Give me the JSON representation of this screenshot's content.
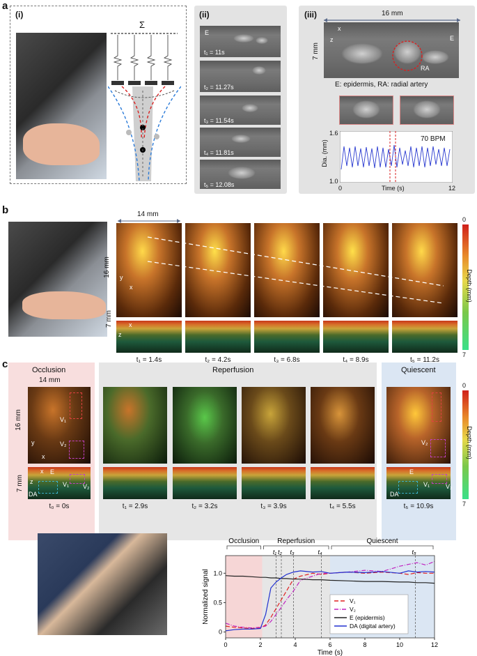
{
  "a": {
    "letter": "a",
    "i": {
      "label": "(i)",
      "sigma": "Σ"
    },
    "ii": {
      "label": "(ii)",
      "e_label": "E",
      "frames": [
        "t₁ = 11s",
        "t₂ = 11.27s",
        "t₃ = 11.54s",
        "t₄ = 11.81s",
        "t₅ = 12.08s"
      ]
    },
    "iii": {
      "label": "(iii)",
      "width": "16 mm",
      "height": "7 mm",
      "e_label": "E",
      "ra_label": "RA",
      "legend": "E: epidermis, RA: radial artery",
      "bpm": "70 BPM",
      "ylabel": "Dia. (mm)",
      "xlabel": "Time (s)",
      "yticks": [
        "1.6",
        "1.0"
      ],
      "xticks": [
        "0",
        "12"
      ],
      "axis_x": "x",
      "axis_z": "z"
    }
  },
  "b": {
    "letter": "b",
    "width": "14 mm",
    "height_top": "16 mm",
    "height_side": "7 mm",
    "depth_label": "Depth (mm)",
    "depth_min": "0",
    "depth_max": "7",
    "frames": [
      "t₁ = 1.4s",
      "t₂ = 4.2s",
      "t₃ = 6.8s",
      "t₄ = 8.9s",
      "t₅ = 11.2s"
    ],
    "axis_x": "x",
    "axis_y": "y",
    "axis_z": "z"
  },
  "c": {
    "letter": "c",
    "occlusion": "Occlusion",
    "reperfusion": "Reperfusion",
    "quiescent": "Quiescent",
    "width": "14 mm",
    "height_top": "16 mm",
    "height_side": "7 mm",
    "depth_label": "Depth (mm)",
    "depth_min": "0",
    "depth_max": "7",
    "v1": "V₁",
    "v2": "V₂",
    "e": "E",
    "da": "DA",
    "axis_x": "x",
    "axis_y": "y",
    "axis_z": "z",
    "frames": [
      "t₀ = 0s",
      "t₁ = 2.9s",
      "t₂ = 3.2s",
      "t₃ = 3.9s",
      "t₄ = 5.5s",
      "t₅ = 10.9s"
    ]
  },
  "chart_data": {
    "type": "line",
    "ylabel": "Normalized signal",
    "xlabel": "Time (s)",
    "xlim": [
      0,
      12
    ],
    "ylim": [
      -0.1,
      1.3
    ],
    "xticks": [
      "0",
      "2",
      "4",
      "6",
      "8",
      "10",
      "12"
    ],
    "yticks": [
      "0",
      "0.5",
      "1.0"
    ],
    "phase_labels": [
      "Occlusion",
      "Reperfusion",
      "Quiescent"
    ],
    "marker_labels": [
      "t₁",
      "t₂",
      "t₃",
      "t₄",
      "t₅"
    ],
    "markers": [
      2.9,
      3.2,
      3.9,
      5.5,
      10.9
    ],
    "shaded": [
      {
        "from": 0,
        "to": 2.1,
        "color": "#f6d6d6"
      },
      {
        "from": 2.1,
        "to": 6.0,
        "color": "#e6e6e6"
      },
      {
        "from": 6.0,
        "to": 12,
        "color": "#dbe6f3"
      }
    ],
    "x": [
      0,
      0.5,
      1,
      1.5,
      2,
      2.3,
      2.6,
      2.9,
      3.2,
      3.5,
      3.9,
      4.3,
      5,
      5.5,
      6,
      7,
      8,
      9,
      10,
      10.5,
      11,
      11.5,
      12
    ],
    "series": [
      {
        "name": "V₁",
        "color": "#e02020",
        "dash": "6,3",
        "values": [
          0.1,
          0.08,
          0.07,
          0.06,
          0.07,
          0.12,
          0.25,
          0.4,
          0.55,
          0.7,
          0.9,
          0.95,
          1.0,
          0.98,
          1.0,
          1.02,
          1.0,
          1.02,
          1.0,
          0.98,
          1.01,
          1.0,
          1.0
        ]
      },
      {
        "name": "V₂",
        "color": "#c020c0",
        "dash": "6,2,1,2",
        "values": [
          0.15,
          0.1,
          0.08,
          0.07,
          0.08,
          0.1,
          0.18,
          0.3,
          0.42,
          0.55,
          0.7,
          0.88,
          0.95,
          1.0,
          1.0,
          1.02,
          1.05,
          1.03,
          1.12,
          1.15,
          1.18,
          1.14,
          1.2
        ]
      },
      {
        "name": "E (epidermis)",
        "color": "#222222",
        "dash": "",
        "values": [
          0.96,
          0.95,
          0.95,
          0.94,
          0.93,
          0.93,
          0.92,
          0.92,
          0.91,
          0.91,
          0.9,
          0.9,
          0.89,
          0.89,
          0.88,
          0.87,
          0.86,
          0.86,
          0.85,
          0.85,
          0.84,
          0.84,
          0.83
        ]
      },
      {
        "name": "DA (digital artery)",
        "color": "#2030d0",
        "dash": "",
        "values": [
          0.02,
          0.04,
          0.05,
          0.05,
          0.06,
          0.3,
          0.75,
          0.85,
          0.92,
          0.98,
          1.02,
          1.04,
          1.02,
          1.03,
          1.0,
          1.02,
          1.01,
          1.03,
          1.0,
          1.04,
          1.02,
          1.03,
          1.02
        ]
      }
    ]
  }
}
